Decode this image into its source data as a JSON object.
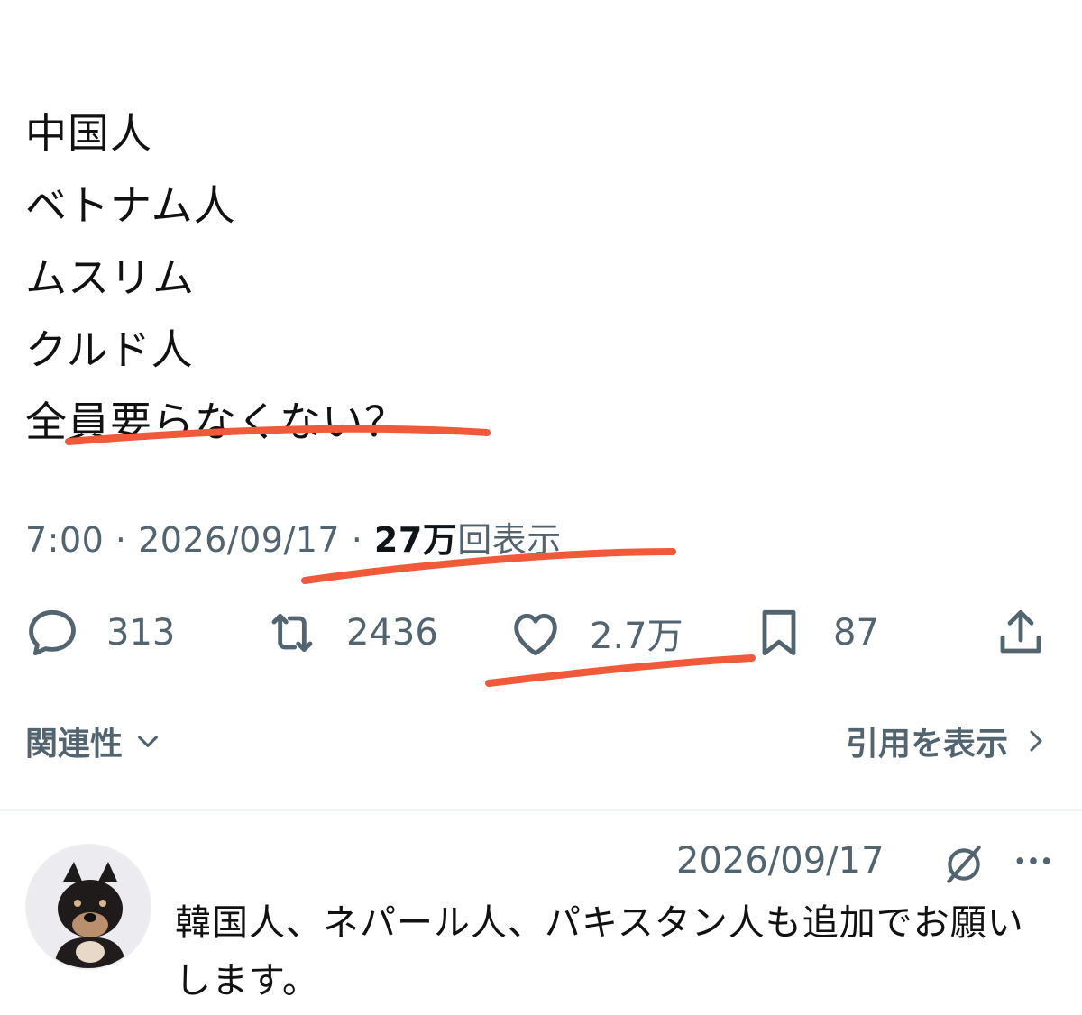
{
  "tweet": {
    "lines": [
      "中国人",
      "ベトナム人",
      "ムスリム",
      "クルド人",
      "全員要らなくない？"
    ]
  },
  "meta": {
    "time": "7:00",
    "sep1": " · ",
    "date": "2026/09/17",
    "sep2": " · ",
    "views_count": "27万",
    "views_label": "回表示"
  },
  "actions": {
    "replies": {
      "icon": "reply-icon",
      "count": "313"
    },
    "reposts": {
      "icon": "repost-icon",
      "count": "2436"
    },
    "likes": {
      "icon": "heart-icon",
      "count": "2.7万"
    },
    "bookmarks": {
      "icon": "bookmark-icon",
      "count": "87"
    },
    "share": {
      "icon": "share-icon"
    }
  },
  "sort": {
    "label": "関連性",
    "icon": "chevron-down-icon"
  },
  "quotes": {
    "label": "引用を表示",
    "icon": "chevron-right-icon"
  },
  "reply": {
    "date": "2026/09/17",
    "text": "韓国人、ネパール人、パキスタン人も追加でお願いします。",
    "icons": [
      "grok-icon",
      "more-icon"
    ]
  },
  "colors": {
    "text": "#0f1419",
    "secondary": "#536471",
    "annotation_red": "#f05a3a",
    "divider": "#eff3f4"
  }
}
